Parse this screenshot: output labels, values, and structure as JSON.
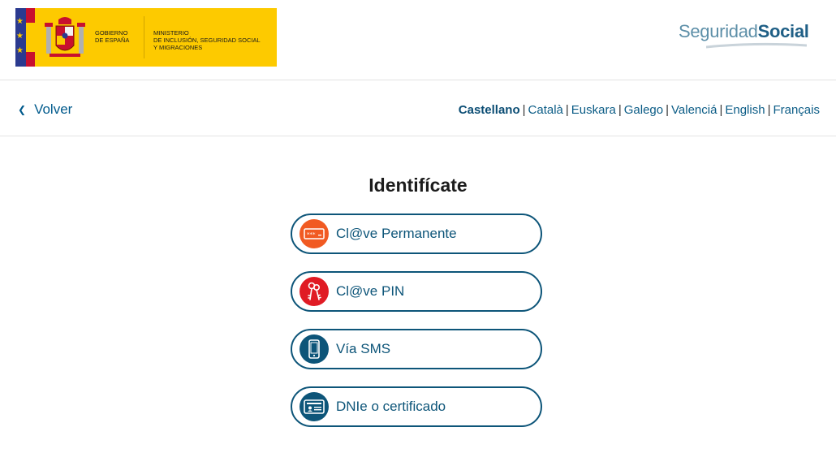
{
  "header": {
    "gov_line1": "GOBIERNO",
    "gov_line2": "DE ESPAÑA",
    "ministry_line1": "MINISTERIO",
    "ministry_line2": "DE INCLUSIÓN, SEGURIDAD SOCIAL",
    "ministry_line3": "Y MIGRACIONES",
    "logo_light": "Seguridad",
    "logo_bold": "Social"
  },
  "nav": {
    "back_label": "Volver",
    "languages": [
      "Castellano",
      "Català",
      "Euskara",
      "Galego",
      "Valenciá",
      "English",
      "Français"
    ],
    "active_language": "Castellano"
  },
  "main": {
    "title": "Identifícate",
    "options": [
      {
        "label": "Cl@ve Permanente",
        "icon": "password-field-icon",
        "color": "#f15a22"
      },
      {
        "label": "Cl@ve PIN",
        "icon": "pin-keys-icon",
        "color": "#e01b24"
      },
      {
        "label": "Vía SMS",
        "icon": "mobile-phone-icon",
        "color": "#0d5579"
      },
      {
        "label": "DNIe o certificado",
        "icon": "id-card-icon",
        "color": "#0d5579"
      }
    ]
  },
  "colors": {
    "brand_blue": "#0d5579",
    "gov_yellow": "#fdca00",
    "eu_blue": "#2b3a8f"
  }
}
